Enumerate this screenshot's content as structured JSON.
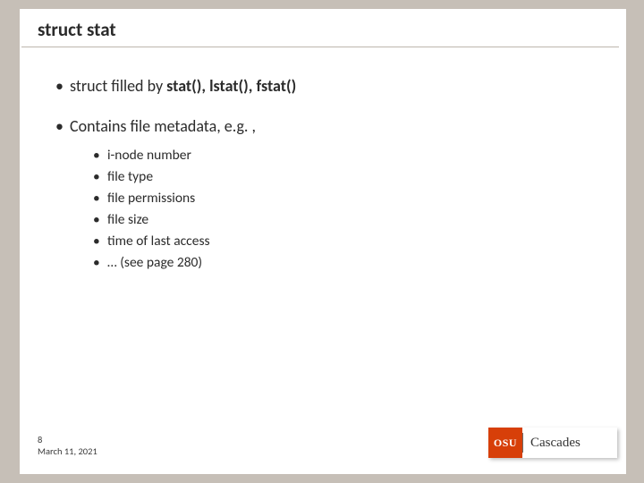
{
  "title": "struct stat",
  "bullets": [
    {
      "prefix": "struct filled by ",
      "strong": "stat(), lstat(), fstat()"
    },
    {
      "prefix": "Contains file metadata, e.g. ,",
      "strong": ""
    }
  ],
  "sublist": [
    "i-node number",
    "file type",
    "file permissions",
    "file size",
    "time of last access",
    "… (see page 280)"
  ],
  "footer": {
    "page": "8",
    "date": "March 11, 2021"
  },
  "logo": {
    "mark": "OSU",
    "text": "Cascades"
  }
}
